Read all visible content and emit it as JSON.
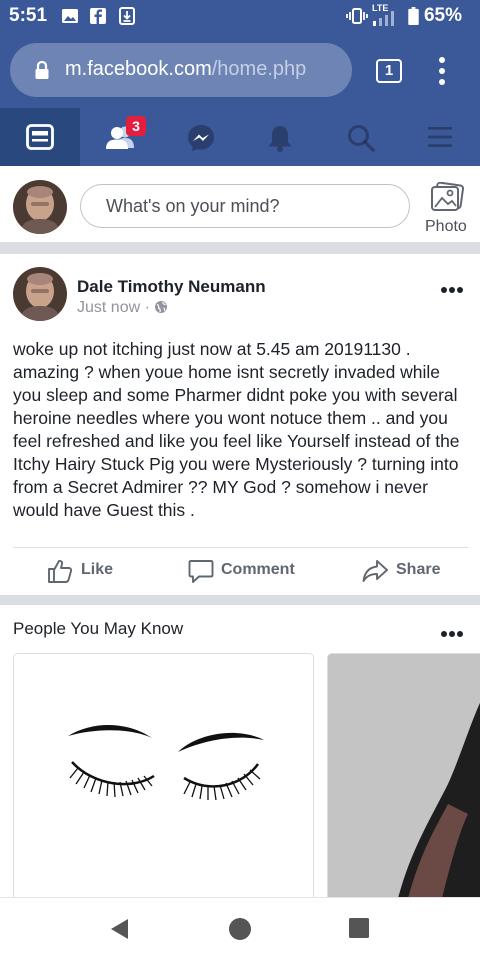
{
  "status_bar": {
    "time": "5:51",
    "network": "LTE",
    "battery_percent": "65%",
    "icons": [
      "gallery-icon",
      "facebook-notification-icon",
      "download-icon",
      "vibrate-icon",
      "signal-icon",
      "battery-icon"
    ]
  },
  "browser": {
    "url_host": "m.facebook.com",
    "url_path": "/home.php",
    "tab_count": "1"
  },
  "nav": {
    "items": [
      "news-feed-icon",
      "friend-requests-icon",
      "messenger-icon",
      "notifications-icon",
      "search-icon",
      "menu-icon"
    ],
    "friend_requests_badge": "3",
    "active": "news-feed-icon"
  },
  "composer": {
    "placeholder": "What's on your mind?",
    "photo_label": "Photo"
  },
  "post": {
    "author": "Dale Timothy Neumann",
    "time": "Just now",
    "meta_separator": "·",
    "body": "woke up not itching just now at 5.45 am 20191130 . amazing ? when youe home isnt secretly invaded while you sleep and some Pharmer didnt poke you with several heroine needles where you wont notuce them .. and you feel refreshed and like you feel like Yourself instead of the Itchy Hairy Stuck Pig you were Mysteriously ? turning into from a Secret Admirer ?? MY God ? somehow i never would have Guest this .",
    "actions": {
      "like": "Like",
      "comment": "Comment",
      "share": "Share"
    }
  },
  "pymk": {
    "title": "People You May Know"
  },
  "colors": {
    "facebook_blue": "#3b5998",
    "active_tab": "#29487d",
    "badge_red": "#e41e3f",
    "separator": "#dadde1"
  }
}
